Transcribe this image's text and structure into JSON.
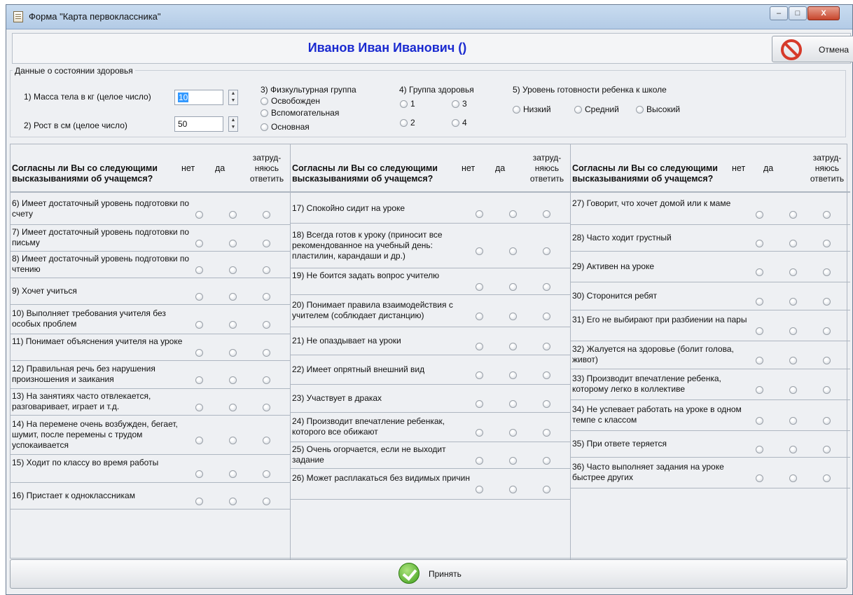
{
  "window": {
    "title": "Форма \"Карта первоклассника\"",
    "btn_min": "–",
    "btn_max": "□",
    "btn_close": "X"
  },
  "header": {
    "student_name": "Иванов Иван Иванович ()",
    "cancel_label": "Отмена"
  },
  "health": {
    "legend": "Данные о состоянии здоровья",
    "weight_label": "1) Масса тела в кг (целое число)",
    "weight_value": "10",
    "height_label": "2) Рост в см (целое число)",
    "height_value": "50",
    "pe_group": {
      "label": "3) Физкультурная группа",
      "options": [
        "Освобожден",
        "Вспомогательная",
        "Основная"
      ]
    },
    "health_group": {
      "label": "4) Группа здоровья",
      "options": [
        "1",
        "2",
        "3",
        "4"
      ]
    },
    "readiness": {
      "label": "5) Уровень готовности ребенка к школе",
      "options": [
        "Низкий",
        "Средний",
        "Высокий"
      ]
    }
  },
  "questions_header": {
    "title": "Согласны ли Вы со следующими высказываниями об учащемся?",
    "no": "нет",
    "yes": "да",
    "hard": "затруд- няюсь ответить"
  },
  "columns": [
    {
      "items": [
        "6) Имеет достаточный уровень подготовки по счету",
        "7) Имеет достаточный уровень подготовки по письму",
        "8) Имеет достаточный уровень подготовки по чтению",
        "9) Хочет учиться",
        "10) Выполняет требования учителя без особых проблем",
        "11) Понимает объяснения учителя на уроке",
        "12) Правильная речь без нарушения произношения и заикания",
        "13) На занятиях часто отвлекается, разговаривает, играет и т.д.",
        "14) На перемене очень возбужден, бегает, шумит, после перемены с трудом успокаивается",
        "15) Ходит по классу во время работы",
        "16) Пристает к одноклассникам"
      ]
    },
    {
      "items": [
        "17) Спокойно сидит на уроке",
        "18) Всегда готов к уроку (приносит все рекомендованное на учебный день: пластилин, карандаши и др.)",
        "19) Не боится задать вопрос учителю",
        "20) Понимает правила взаимодействия с учителем (соблюдает дистанцию)",
        "21) Не опаздывает на уроки",
        "22) Имеет опрятный внешний вид",
        "23) Участвует в драках",
        "24) Производит впечатление ребенкак, которого все обижают",
        "25) Очень огорчается, если не выходит задание",
        "26) Может расплакаться без видимых причин"
      ]
    },
    {
      "items": [
        "27) Говорит, что хочет домой или к маме",
        "28) Часто ходит грустный",
        "29) Активен на уроке",
        "30) Сторонится ребят",
        "31) Его не выбирают при разбиении на пары",
        "32) Жалуется на здоровье (болит голова, живот)",
        "33) Производит впечатление ребенка, которому легко в коллективе",
        "34) Не успевает работать на уроке в одном темпе с классом",
        "35) При ответе теряется",
        "36) Часто выполняет задания на уроке быстрее других"
      ]
    }
  ],
  "footer": {
    "accept_label": "Принять"
  }
}
